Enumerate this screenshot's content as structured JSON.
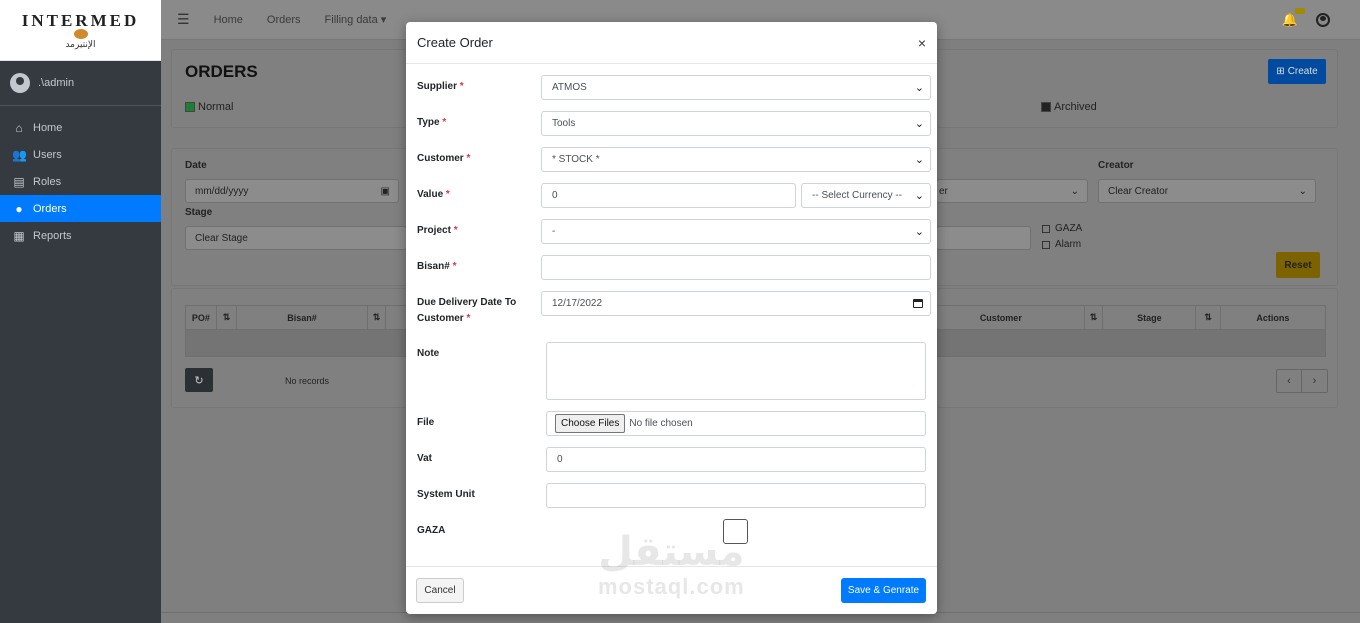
{
  "brand": {
    "logo_text": "INTERMED",
    "logo_arabic": "الإنتيرمد"
  },
  "sidebar": {
    "user": ".\\admin",
    "items": [
      {
        "label": "Home",
        "icon": "home-icon",
        "glyph": "⌂"
      },
      {
        "label": "Users",
        "icon": "users-icon",
        "glyph": "👥"
      },
      {
        "label": "Roles",
        "icon": "roles-icon",
        "glyph": "▤"
      },
      {
        "label": "Orders",
        "icon": "orders-icon",
        "glyph": "●"
      },
      {
        "label": "Reports",
        "icon": "reports-icon",
        "glyph": "▦"
      }
    ],
    "active": "Orders"
  },
  "topbar": {
    "menu_glyph": "☰",
    "links": [
      "Home",
      "Orders",
      "Filling data ▾"
    ]
  },
  "orders": {
    "title": "ORDERS",
    "create_label": "Create",
    "legend": [
      {
        "label": "Normal",
        "color": "#1e7e34"
      },
      {
        "label": "Archived",
        "color": "#222222"
      }
    ]
  },
  "filters": {
    "date_label": "Date",
    "date_placeholder": "mm/dd/yyyy",
    "stage_label": "Stage",
    "stage_value": "Clear Stage",
    "creator_label": "Creator",
    "creator_value": "Clear Creator",
    "partial_value": "er",
    "checks": [
      "GAZA",
      "Alarm"
    ],
    "reset_label": "Reset"
  },
  "table": {
    "columns": [
      "PO#",
      "Bisan#",
      "Customer",
      "Stage",
      "Actions"
    ],
    "sort_glyph": "⇅",
    "empty_text": "No records",
    "refresh_glyph": "↻",
    "prev_glyph": "‹",
    "next_glyph": "›"
  },
  "modal": {
    "title": "Create Order",
    "close_glyph": "×",
    "required_mark": "*",
    "fields": {
      "supplier": {
        "label": "Supplier",
        "value": "ATMOS"
      },
      "type": {
        "label": "Type",
        "value": "Tools"
      },
      "customer": {
        "label": "Customer",
        "value": "* STOCK *"
      },
      "value": {
        "label": "Value",
        "value": "0",
        "currency_placeholder": "-- Select Currency --"
      },
      "project": {
        "label": "Project",
        "value": "-"
      },
      "bisan": {
        "label": "Bisan#",
        "value": ""
      },
      "due_date": {
        "label_line1": "Due Delivery Date To",
        "label_line2": "Customer",
        "value": "12/17/2022"
      },
      "note": {
        "label": "Note",
        "value": ""
      },
      "file": {
        "label": "File",
        "button": "Choose Files",
        "status": "No file chosen"
      },
      "vat": {
        "label": "Vat",
        "value": "0"
      },
      "system_unit": {
        "label": "System Unit",
        "value": ""
      },
      "gaza": {
        "label": "GAZA",
        "checked": false
      }
    },
    "cancel_label": "Cancel",
    "save_label": "Save & Genrate"
  },
  "watermark": {
    "arabic": "مستقل",
    "latin": "mostaql.com"
  }
}
